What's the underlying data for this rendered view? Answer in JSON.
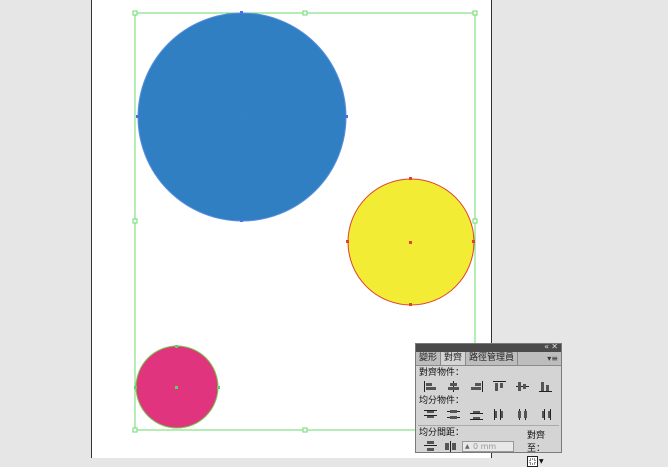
{
  "canvas": {
    "shapes": [
      {
        "name": "blue-circle",
        "fill": "#317fc3"
      },
      {
        "name": "yellow-circle",
        "fill": "#f2ec35",
        "stroke": "#e0402f"
      },
      {
        "name": "pink-circle",
        "fill": "#e0357e",
        "stroke": "#7ac74d"
      }
    ],
    "selection_color": "#6bdc6b"
  },
  "panel": {
    "tabs": [
      {
        "label": "變形",
        "active": false
      },
      {
        "label": "對齊",
        "active": true
      },
      {
        "label": "路徑管理員",
        "active": false
      }
    ],
    "align_objects_label": "對齊物件：",
    "distribute_objects_label": "均分物件：",
    "distribute_spacing_label": "均分間距：",
    "spacing_value": "0 mm",
    "align_to_label": "對齊至："
  }
}
